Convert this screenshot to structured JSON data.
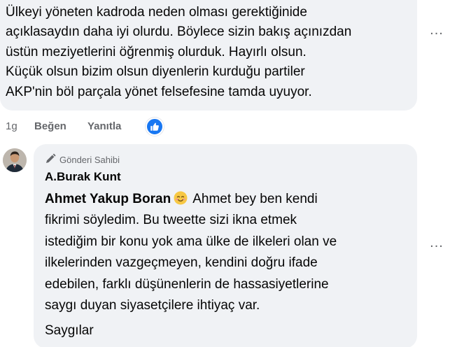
{
  "comment": {
    "lines": [
      "Ülkeyi yöneten kadroda neden olması gerektiğinide",
      "açıklasaydın daha iyi olurdu. Böylece sizin bakış açınızdan",
      "üstün meziyetlerini öğrenmiş olurduk. Hayırlı olsun.",
      "Küçük olsun bizim olsun diyenlerin kurduğu partiler",
      "AKP'nin böl parçala yönet felsefesine tamda uyuyor."
    ],
    "time": "1g",
    "like_label": "Beğen",
    "reply_label": "Yanıtla",
    "more_label": "..."
  },
  "reply": {
    "badge": "Gönderi Sahibi",
    "author": "A.Burak Kunt",
    "mention": "Ahmet Yakup Boran",
    "lines": [
      "Ahmet bey ben kendi",
      "fikrimi söyledim. Bu tweette sizi ikna etmek",
      "istediğim bir konu yok ama ülke de ilkeleri olan ve",
      "ilkelerinden vazgeçmeyen, kendini doğru ifade",
      "edebilen, farklı düşünenlerin de hassasiyetlerine",
      "saygı duyan siyasetçilere ihtiyaç var."
    ],
    "signoff": "Saygılar",
    "more_label": "..."
  },
  "icons": {
    "like_reaction": "thumbs-up-icon",
    "badge": "pencil-icon",
    "emoji": "smiling-face-icon"
  },
  "colors": {
    "bubble": "#f0f2f5",
    "secondary_text": "#65676b",
    "like_blue": "#1877f2"
  }
}
